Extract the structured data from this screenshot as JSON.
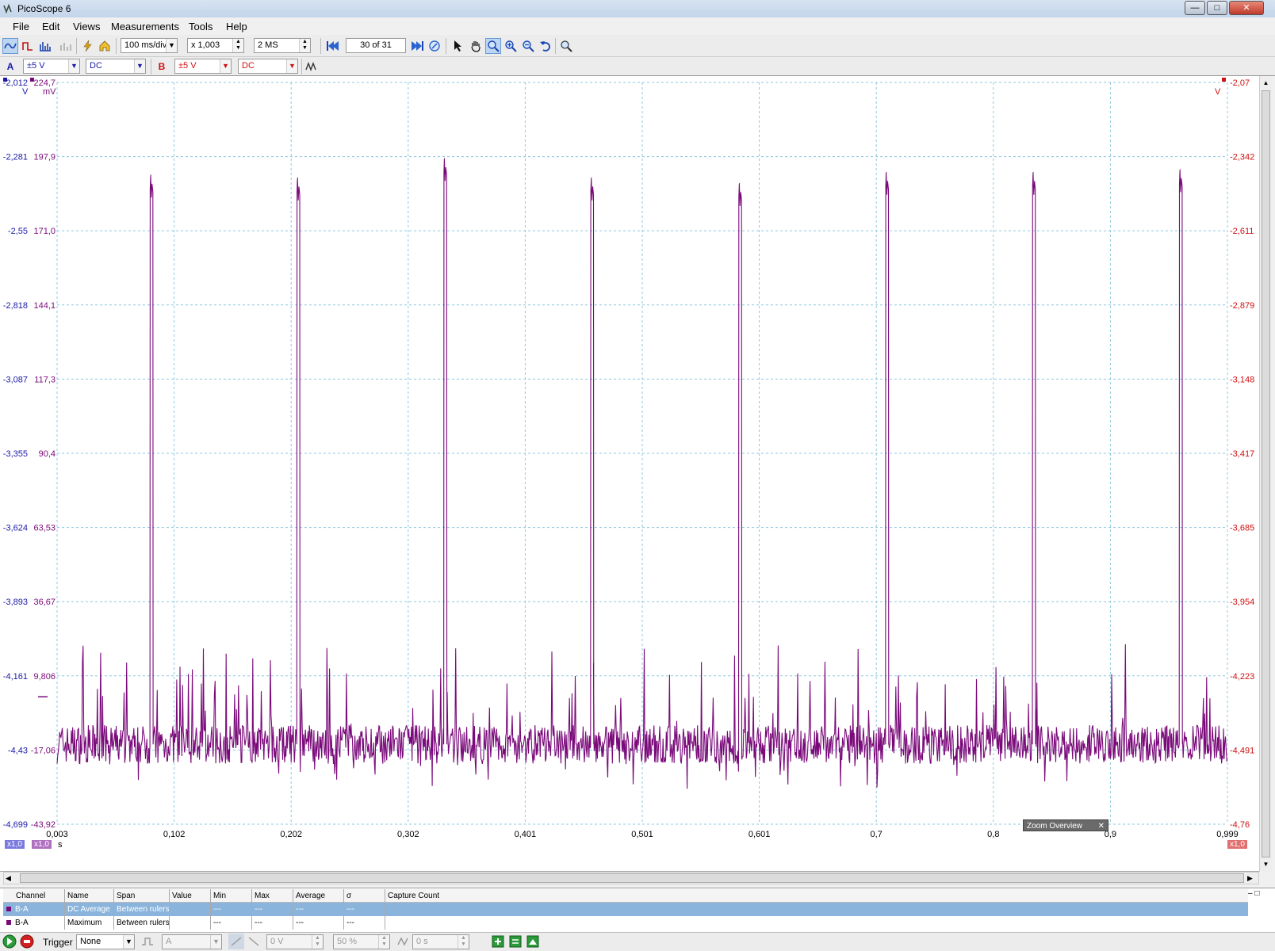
{
  "window": {
    "title": "PicoScope 6"
  },
  "menu": [
    "File",
    "Edit",
    "Views",
    "Measurements",
    "Tools",
    "Help"
  ],
  "toolbar": {
    "timebase": "100 ms/div",
    "zoom": "x 1,003",
    "samples": "2 MS",
    "buffer": "30  of 31"
  },
  "channels": {
    "a": {
      "label": "A",
      "range": "±5 V",
      "coupling": "DC",
      "color": "#1a1aa8"
    },
    "b": {
      "label": "B",
      "range": "±5 V",
      "coupling": "DC",
      "color": "#d01010"
    }
  },
  "scope": {
    "left_axis_a_unit": "V",
    "left_axis_math_unit": "mV",
    "right_axis_unit": "V",
    "a_axis": [
      "-2,012",
      "-2,281",
      "-2,55",
      "-2,818",
      "-3,087",
      "-3,355",
      "-3,624",
      "-3,893",
      "-4,161",
      "-4,43",
      "-4,699"
    ],
    "math_axis": [
      "224,7",
      "197,9",
      "171,0",
      "144,1",
      "117,3",
      "90,4",
      "63,53",
      "36,67",
      "9,806",
      "-17,06",
      "-43,92"
    ],
    "b_axis": [
      "-2,07",
      "-2,342",
      "-2,611",
      "-2,879",
      "-3,148",
      "-3,417",
      "-3,685",
      "-3,954",
      "-4,223",
      "-4,491",
      "-4,76"
    ],
    "x_axis": [
      "0,003",
      "0,102",
      "0,202",
      "0,302",
      "0,401",
      "0,501",
      "0,601",
      "0,7",
      "0,8",
      "0,9",
      "0,999"
    ],
    "x_unit": "s",
    "zoom_a": "x1,0",
    "zoom_math": "x1,0",
    "zoom_b": "x1,0",
    "zoom_overview": "Zoom Overview",
    "trace_color": "#7a0a7a"
  },
  "chart_data": {
    "type": "line",
    "x_unit": "s",
    "xlim": [
      0.003,
      0.999
    ],
    "ylim_mv": [
      -43.92,
      224.7
    ],
    "series": [
      {
        "pulse_times_s": [
          0.082,
          0.207,
          0.332,
          0.457,
          0.583,
          0.708,
          0.833,
          0.958
        ],
        "pulse_peaks_mv": [
          191,
          190,
          197,
          190,
          188,
          192,
          192,
          193
        ],
        "baseline_mv": -15
      }
    ]
  },
  "measurements": {
    "headers": [
      "Channel",
      "Name",
      "Span",
      "Value",
      "Min",
      "Max",
      "Average",
      "σ",
      "Capture Count"
    ],
    "rows": [
      [
        "B-A",
        "DC Average",
        "Between rulers",
        "",
        "---",
        "---",
        "---",
        "---",
        ""
      ],
      [
        "B-A",
        "Maximum",
        "Between rulers",
        "",
        "---",
        "---",
        "---",
        "---",
        ""
      ]
    ]
  },
  "bottom": {
    "trigger_label": "Trigger",
    "trigger_mode": "None",
    "trigger_source": "A",
    "threshold": "0 V",
    "pretrigger": "50 %",
    "delay": "0 s"
  }
}
